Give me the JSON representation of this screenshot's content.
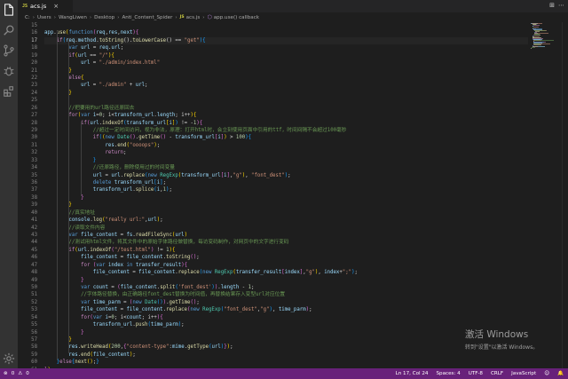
{
  "tab": {
    "icon_label": "JS",
    "filename": "acs.js",
    "close": "×"
  },
  "tab_actions": [
    "⊞",
    "⋯"
  ],
  "breadcrumb": [
    "C:",
    "Users",
    "WangLiwen",
    "Desktop",
    "Anti_Content_Spider",
    "acs.js",
    "app.use() callback"
  ],
  "breadcrumb_js_label": "JS",
  "gutter": {
    "start": 15,
    "end": 60,
    "active": 17
  },
  "code_lines": [
    [
      [
        "pl",
        ""
      ]
    ],
    [
      [
        "vr",
        "app"
      ],
      [
        "pl",
        "."
      ],
      [
        "fn",
        "use"
      ],
      [
        "br1",
        "("
      ],
      [
        "kw",
        "function"
      ],
      [
        "br2",
        "("
      ],
      [
        "vr",
        "req"
      ],
      [
        "pl",
        ","
      ],
      [
        "vr",
        "res"
      ],
      [
        "pl",
        ","
      ],
      [
        "vr",
        "next"
      ],
      [
        "br2",
        ")"
      ],
      [
        "br2",
        "{"
      ]
    ],
    [
      [
        "pl",
        "    "
      ],
      [
        "ctl",
        "if"
      ],
      [
        "br3",
        "("
      ],
      [
        "vr",
        "req"
      ],
      [
        "pl",
        "."
      ],
      [
        "vr",
        "method"
      ],
      [
        "pl",
        "."
      ],
      [
        "fn",
        "toString"
      ],
      [
        "pl",
        "()."
      ],
      [
        "fn",
        "toLowerCase"
      ],
      [
        "pl",
        "() == "
      ],
      [
        "str",
        "\"get\""
      ],
      [
        "br3",
        ")"
      ],
      [
        "br3",
        "{"
      ]
    ],
    [
      [
        "pl",
        "        "
      ],
      [
        "kw",
        "var"
      ],
      [
        "pl",
        " "
      ],
      [
        "vr",
        "url"
      ],
      [
        "pl",
        " = "
      ],
      [
        "vr",
        "req"
      ],
      [
        "pl",
        "."
      ],
      [
        "vr",
        "url"
      ],
      [
        "pl",
        ";"
      ]
    ],
    [
      [
        "pl",
        "        "
      ],
      [
        "ctl",
        "if"
      ],
      [
        "br1",
        "("
      ],
      [
        "vr",
        "url"
      ],
      [
        "pl",
        " == "
      ],
      [
        "str",
        "\"/\""
      ],
      [
        "br1",
        ")"
      ],
      [
        "br1",
        "{"
      ]
    ],
    [
      [
        "pl",
        "            "
      ],
      [
        "vr",
        "url"
      ],
      [
        "pl",
        " = "
      ],
      [
        "str",
        "\"./admin/index.html\""
      ]
    ],
    [
      [
        "pl",
        "        "
      ],
      [
        "br1",
        "}"
      ]
    ],
    [
      [
        "pl",
        "        "
      ],
      [
        "ctl",
        "else"
      ],
      [
        "br1",
        "{"
      ]
    ],
    [
      [
        "pl",
        "            "
      ],
      [
        "vr",
        "url"
      ],
      [
        "pl",
        " = "
      ],
      [
        "str",
        "\"./admin\""
      ],
      [
        "pl",
        " + "
      ],
      [
        "vr",
        "url"
      ],
      [
        "pl",
        ";"
      ]
    ],
    [
      [
        "pl",
        "        "
      ],
      [
        "br1",
        "}"
      ]
    ],
    [
      [
        "pl",
        ""
      ]
    ],
    [
      [
        "pl",
        "        "
      ],
      [
        "cm",
        "//把要用的url路径还原回去"
      ]
    ],
    [
      [
        "pl",
        "        "
      ],
      [
        "ctl",
        "for"
      ],
      [
        "br1",
        "("
      ],
      [
        "kw",
        "var"
      ],
      [
        "pl",
        " "
      ],
      [
        "vr",
        "i"
      ],
      [
        "pl",
        "="
      ],
      [
        "num",
        "0"
      ],
      [
        "pl",
        "; i<"
      ],
      [
        "vr",
        "transform_url"
      ],
      [
        "pl",
        "."
      ],
      [
        "vr",
        "length"
      ],
      [
        "pl",
        "; i++"
      ],
      [
        "br1",
        ")"
      ],
      [
        "br1",
        "{"
      ]
    ],
    [
      [
        "pl",
        "            "
      ],
      [
        "ctl",
        "if"
      ],
      [
        "br2",
        "("
      ],
      [
        "vr",
        "url"
      ],
      [
        "pl",
        "."
      ],
      [
        "fn",
        "indexOf"
      ],
      [
        "br3",
        "("
      ],
      [
        "vr",
        "transform_url"
      ],
      [
        "br1",
        "["
      ],
      [
        "vr",
        "i"
      ],
      [
        "br1",
        "]"
      ],
      [
        "br3",
        ")"
      ],
      [
        "pl",
        " != -"
      ],
      [
        "num",
        "1"
      ],
      [
        "br2",
        ")"
      ],
      [
        "br2",
        "{"
      ]
    ],
    [
      [
        "pl",
        "                "
      ],
      [
        "cm",
        "//超过一定时间访问，视为非法，原理：打开html时，会立刻使用页面中引用的ttf，时间间隔不会超过100毫秒"
      ]
    ],
    [
      [
        "pl",
        "                "
      ],
      [
        "ctl",
        "if"
      ],
      [
        "br3",
        "("
      ],
      [
        "br1",
        "("
      ],
      [
        "kw",
        "new"
      ],
      [
        "pl",
        " "
      ],
      [
        "cls",
        "Date"
      ],
      [
        "br2",
        "()"
      ],
      [
        "pl",
        "."
      ],
      [
        "fn",
        "getTime"
      ],
      [
        "br2",
        "()"
      ],
      [
        "pl",
        " - "
      ],
      [
        "vr",
        "transform_url"
      ],
      [
        "br2",
        "["
      ],
      [
        "vr",
        "i"
      ],
      [
        "br2",
        "]"
      ],
      [
        "br1",
        ")"
      ],
      [
        "pl",
        " > "
      ],
      [
        "num",
        "100"
      ],
      [
        "br3",
        ")"
      ],
      [
        "br3",
        "{"
      ]
    ],
    [
      [
        "pl",
        "                    "
      ],
      [
        "vr",
        "res"
      ],
      [
        "pl",
        "."
      ],
      [
        "fn",
        "end"
      ],
      [
        "br1",
        "("
      ],
      [
        "str",
        "\"oooops\""
      ],
      [
        "br1",
        ")"
      ],
      [
        "pl",
        ";"
      ]
    ],
    [
      [
        "pl",
        "                    "
      ],
      [
        "ctl",
        "return"
      ],
      [
        "pl",
        ";"
      ]
    ],
    [
      [
        "pl",
        "                "
      ],
      [
        "br3",
        "}"
      ]
    ],
    [
      [
        "pl",
        "                "
      ],
      [
        "cm",
        "//还原路径，删除使用过的时间变量"
      ]
    ],
    [
      [
        "pl",
        "                "
      ],
      [
        "vr",
        "url"
      ],
      [
        "pl",
        " = "
      ],
      [
        "vr",
        "url"
      ],
      [
        "pl",
        "."
      ],
      [
        "fn",
        "replace"
      ],
      [
        "br3",
        "("
      ],
      [
        "kw",
        "new"
      ],
      [
        "pl",
        " "
      ],
      [
        "cls",
        "RegExp"
      ],
      [
        "br1",
        "("
      ],
      [
        "vr",
        "transform_url"
      ],
      [
        "br2",
        "["
      ],
      [
        "vr",
        "i"
      ],
      [
        "br2",
        "]"
      ],
      [
        "pl",
        ","
      ],
      [
        "str",
        "\"g\""
      ],
      [
        "br1",
        ")"
      ],
      [
        "pl",
        ", "
      ],
      [
        "str",
        "\"font_dest\""
      ],
      [
        "br3",
        ")"
      ],
      [
        "pl",
        ";"
      ]
    ],
    [
      [
        "pl",
        "                "
      ],
      [
        "kw",
        "delete"
      ],
      [
        "pl",
        " "
      ],
      [
        "vr",
        "transform_url"
      ],
      [
        "br3",
        "["
      ],
      [
        "vr",
        "i"
      ],
      [
        "br3",
        "]"
      ],
      [
        "pl",
        ";"
      ]
    ],
    [
      [
        "pl",
        "                "
      ],
      [
        "vr",
        "transform_url"
      ],
      [
        "pl",
        "."
      ],
      [
        "fn",
        "splice"
      ],
      [
        "br3",
        "("
      ],
      [
        "vr",
        "i"
      ],
      [
        "pl",
        ","
      ],
      [
        "num",
        "1"
      ],
      [
        "br3",
        ")"
      ],
      [
        "pl",
        ";"
      ]
    ],
    [
      [
        "pl",
        "            "
      ],
      [
        "br2",
        "}"
      ]
    ],
    [
      [
        "pl",
        "        "
      ],
      [
        "br1",
        "}"
      ]
    ],
    [
      [
        "pl",
        "        "
      ],
      [
        "cm",
        "//真实地址"
      ]
    ],
    [
      [
        "pl",
        "        "
      ],
      [
        "vr",
        "console"
      ],
      [
        "pl",
        "."
      ],
      [
        "fn",
        "log"
      ],
      [
        "br1",
        "("
      ],
      [
        "str",
        "\"really url:\""
      ],
      [
        "pl",
        ","
      ],
      [
        "vr",
        "url"
      ],
      [
        "br1",
        ")"
      ],
      [
        "pl",
        ";"
      ]
    ],
    [
      [
        "pl",
        "        "
      ],
      [
        "cm",
        "//读取文件内容"
      ]
    ],
    [
      [
        "pl",
        "        "
      ],
      [
        "kw",
        "var"
      ],
      [
        "pl",
        " "
      ],
      [
        "vr",
        "file_content"
      ],
      [
        "pl",
        " = "
      ],
      [
        "vr",
        "fs"
      ],
      [
        "pl",
        "."
      ],
      [
        "fn",
        "readFileSync"
      ],
      [
        "br1",
        "("
      ],
      [
        "vr",
        "url"
      ],
      [
        "br1",
        ")"
      ]
    ],
    [
      [
        "pl",
        "        "
      ],
      [
        "cm",
        "//测试用html文件，将其文件中的原始字体路径做替换，每访变码制作，对网页中的文字进行变码"
      ]
    ],
    [
      [
        "pl",
        "        "
      ],
      [
        "ctl",
        "if"
      ],
      [
        "br1",
        "("
      ],
      [
        "vr",
        "url"
      ],
      [
        "pl",
        "."
      ],
      [
        "fn",
        "indexOf"
      ],
      [
        "br2",
        "("
      ],
      [
        "str",
        "\"/test.html\""
      ],
      [
        "br2",
        ")"
      ],
      [
        "pl",
        " != "
      ],
      [
        "num",
        "1"
      ],
      [
        "br1",
        ")"
      ],
      [
        "br1",
        "{"
      ]
    ],
    [
      [
        "pl",
        "            "
      ],
      [
        "vr",
        "file_content"
      ],
      [
        "pl",
        " = "
      ],
      [
        "vr",
        "file_content"
      ],
      [
        "pl",
        "."
      ],
      [
        "fn",
        "toString"
      ],
      [
        "br2",
        "()"
      ],
      [
        "pl",
        ";"
      ]
    ],
    [
      [
        "pl",
        "            "
      ],
      [
        "ctl",
        "for"
      ],
      [
        "pl",
        " "
      ],
      [
        "br2",
        "("
      ],
      [
        "kw",
        "var"
      ],
      [
        "pl",
        " "
      ],
      [
        "vr",
        "index"
      ],
      [
        "pl",
        " "
      ],
      [
        "kw",
        "in"
      ],
      [
        "pl",
        " "
      ],
      [
        "vr",
        "transfer_result"
      ],
      [
        "br2",
        ")"
      ],
      [
        "br2",
        "{"
      ]
    ],
    [
      [
        "pl",
        "                "
      ],
      [
        "vr",
        "file_content"
      ],
      [
        "pl",
        " = "
      ],
      [
        "vr",
        "file_content"
      ],
      [
        "pl",
        "."
      ],
      [
        "fn",
        "replace"
      ],
      [
        "br3",
        "("
      ],
      [
        "kw",
        "new"
      ],
      [
        "pl",
        " "
      ],
      [
        "cls",
        "RegExp"
      ],
      [
        "br1",
        "("
      ],
      [
        "vr",
        "transfer_result"
      ],
      [
        "br2",
        "["
      ],
      [
        "vr",
        "index"
      ],
      [
        "br2",
        "]"
      ],
      [
        "pl",
        ","
      ],
      [
        "str",
        "\"g\""
      ],
      [
        "br1",
        ")"
      ],
      [
        "pl",
        ", "
      ],
      [
        "vr",
        "index"
      ],
      [
        "pl",
        "+"
      ],
      [
        "str",
        "\";\""
      ],
      [
        "br3",
        ")"
      ],
      [
        "pl",
        ";"
      ]
    ],
    [
      [
        "pl",
        "            "
      ],
      [
        "br2",
        "}"
      ]
    ],
    [
      [
        "pl",
        "            "
      ],
      [
        "kw",
        "var"
      ],
      [
        "pl",
        " "
      ],
      [
        "vr",
        "count"
      ],
      [
        "pl",
        " = "
      ],
      [
        "br2",
        "("
      ],
      [
        "vr",
        "file_content"
      ],
      [
        "pl",
        "."
      ],
      [
        "fn",
        "split"
      ],
      [
        "br3",
        "("
      ],
      [
        "str",
        "'font_dest'"
      ],
      [
        "br3",
        ")"
      ],
      [
        "br2",
        ")"
      ],
      [
        "pl",
        "."
      ],
      [
        "vr",
        "length"
      ],
      [
        "pl",
        " - "
      ],
      [
        "num",
        "1"
      ],
      [
        "pl",
        ";"
      ]
    ],
    [
      [
        "pl",
        "            "
      ],
      [
        "cm",
        "//字体路径替换，由正确路径font_dest替换为时间值，再替换结果存入变型url对应位置"
      ]
    ],
    [
      [
        "pl",
        "            "
      ],
      [
        "kw",
        "var"
      ],
      [
        "pl",
        " "
      ],
      [
        "vr",
        "time_parm"
      ],
      [
        "pl",
        " = "
      ],
      [
        "br2",
        "("
      ],
      [
        "kw",
        "new"
      ],
      [
        "pl",
        " "
      ],
      [
        "cls",
        "Date"
      ],
      [
        "br3",
        "()"
      ],
      [
        "br2",
        ")"
      ],
      [
        "pl",
        "."
      ],
      [
        "fn",
        "getTime"
      ],
      [
        "br2",
        "()"
      ],
      [
        "pl",
        ";"
      ]
    ],
    [
      [
        "pl",
        "            "
      ],
      [
        "vr",
        "file_content"
      ],
      [
        "pl",
        " = "
      ],
      [
        "vr",
        "file_content"
      ],
      [
        "pl",
        "."
      ],
      [
        "fn",
        "replace"
      ],
      [
        "br2",
        "("
      ],
      [
        "kw",
        "new"
      ],
      [
        "pl",
        " "
      ],
      [
        "cls",
        "RegExp"
      ],
      [
        "br3",
        "("
      ],
      [
        "str",
        "\"font_dest\""
      ],
      [
        "pl",
        ","
      ],
      [
        "str",
        "\"g\""
      ],
      [
        "br3",
        ")"
      ],
      [
        "pl",
        ", "
      ],
      [
        "vr",
        "time_parm"
      ],
      [
        "br2",
        ")"
      ],
      [
        "pl",
        ";"
      ]
    ],
    [
      [
        "pl",
        "            "
      ],
      [
        "ctl",
        "for"
      ],
      [
        "br2",
        "("
      ],
      [
        "kw",
        "var"
      ],
      [
        "pl",
        " "
      ],
      [
        "vr",
        "i"
      ],
      [
        "pl",
        "="
      ],
      [
        "num",
        "0"
      ],
      [
        "pl",
        "; i<"
      ],
      [
        "vr",
        "count"
      ],
      [
        "pl",
        "; i++"
      ],
      [
        "br2",
        ")"
      ],
      [
        "br2",
        "{"
      ]
    ],
    [
      [
        "pl",
        "                "
      ],
      [
        "vr",
        "transform_url"
      ],
      [
        "pl",
        "."
      ],
      [
        "fn",
        "push"
      ],
      [
        "br3",
        "("
      ],
      [
        "vr",
        "time_parm"
      ],
      [
        "br3",
        ")"
      ],
      [
        "pl",
        ";"
      ]
    ],
    [
      [
        "pl",
        "            "
      ],
      [
        "br2",
        "}"
      ]
    ],
    [
      [
        "pl",
        "        "
      ],
      [
        "br1",
        "}"
      ]
    ],
    [
      [
        "pl",
        "        "
      ],
      [
        "vr",
        "res"
      ],
      [
        "pl",
        "."
      ],
      [
        "fn",
        "writeHead"
      ],
      [
        "br1",
        "("
      ],
      [
        "num",
        "200"
      ],
      [
        "pl",
        ","
      ],
      [
        "br2",
        "{"
      ],
      [
        "str",
        "\"content-type\""
      ],
      [
        "pl",
        ":"
      ],
      [
        "vr",
        "mime"
      ],
      [
        "pl",
        "."
      ],
      [
        "fn",
        "getType"
      ],
      [
        "br3",
        "("
      ],
      [
        "vr",
        "url"
      ],
      [
        "br3",
        ")"
      ],
      [
        "br2",
        "}"
      ],
      [
        "br1",
        ")"
      ],
      [
        "pl",
        ";"
      ]
    ],
    [
      [
        "pl",
        "        "
      ],
      [
        "vr",
        "res"
      ],
      [
        "pl",
        "."
      ],
      [
        "fn",
        "end"
      ],
      [
        "br1",
        "("
      ],
      [
        "vr",
        "file_content"
      ],
      [
        "br1",
        ")"
      ],
      [
        "pl",
        ";"
      ]
    ],
    [
      [
        "pl",
        "    "
      ],
      [
        "br3",
        "}"
      ],
      [
        "ctl",
        "else"
      ],
      [
        "br3",
        "{"
      ],
      [
        "fn",
        "next"
      ],
      [
        "br1",
        "()"
      ],
      [
        "pl",
        ";"
      ],
      [
        "br3",
        "}"
      ]
    ],
    [
      [
        "br2",
        "}"
      ],
      [
        "br1",
        ")"
      ]
    ]
  ],
  "watermark": {
    "title": "激活 Windows",
    "subtitle": "转到\"设置\"以激活 Windows。"
  },
  "status": {
    "errors": "0",
    "warnings": "0",
    "position": "Ln 17, Col 24",
    "spaces": "Spaces: 4",
    "encoding": "UTF-8",
    "eol": "CRLF",
    "language": "JavaScript",
    "feedback_icon": "smiley-icon",
    "notification_icon": "bell-icon"
  },
  "colors": {
    "activity_bar": "#333333",
    "editor_bg": "#1e1e1e",
    "status_bar": "#68217a",
    "tab_bar": "#252526"
  }
}
